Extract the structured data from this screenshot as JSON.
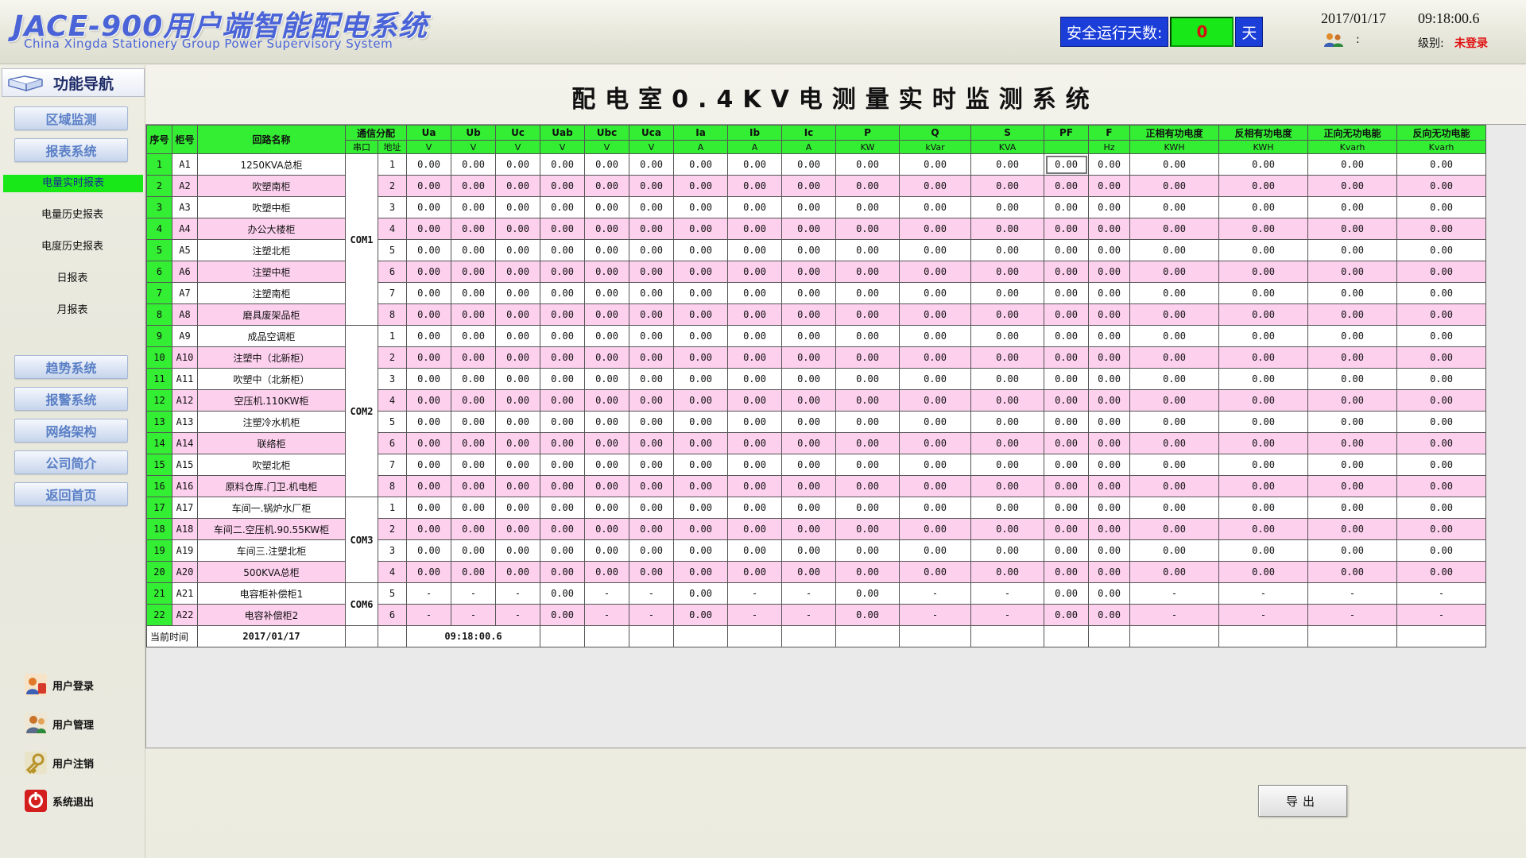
{
  "header": {
    "title": "JACE-900用户端智能配电系统",
    "subtitle": "China Xingda Stationery Group Power Supervisory System",
    "safe_days_label": "安全运行天数:",
    "safe_days_value": "0",
    "safe_days_unit": "天",
    "date": "2017/01/17",
    "time": "09:18:00.6",
    "colon": ":",
    "level_label": "级别:",
    "level_value": "未登录"
  },
  "sidebar": {
    "nav_title": "功能导航",
    "buttons_top": [
      "区域监测",
      "报表系统"
    ],
    "sub_items": [
      "电量实时报表",
      "电量历史报表",
      "电度历史报表",
      "日报表",
      "月报表"
    ],
    "active_sub": 0,
    "buttons_mid": [
      "趋势系统",
      "报警系统",
      "网络架构",
      "公司简介",
      "返回首页"
    ],
    "actions": [
      "用户登录",
      "用户管理",
      "用户注销",
      "系统退出"
    ]
  },
  "main": {
    "title": "配电室0.4KV电测量实时监测系统",
    "export_label": "导出"
  },
  "table": {
    "head": {
      "seq": "序号",
      "cabinet": "柜号",
      "circuit": "回路名称",
      "comm": "通信分配",
      "port": "串口",
      "addr": "地址"
    },
    "measure_columns": [
      {
        "name": "Ua",
        "unit": "V"
      },
      {
        "name": "Ub",
        "unit": "V"
      },
      {
        "name": "Uc",
        "unit": "V"
      },
      {
        "name": "Uab",
        "unit": "V"
      },
      {
        "name": "Ubc",
        "unit": "V"
      },
      {
        "name": "Uca",
        "unit": "V"
      },
      {
        "name": "Ia",
        "unit": "A"
      },
      {
        "name": "Ib",
        "unit": "A"
      },
      {
        "name": "Ic",
        "unit": "A"
      },
      {
        "name": "P",
        "unit": "KW"
      },
      {
        "name": "Q",
        "unit": "kVar"
      },
      {
        "name": "S",
        "unit": "KVA"
      },
      {
        "name": "PF",
        "unit": ""
      },
      {
        "name": "F",
        "unit": "Hz"
      },
      {
        "name": "正相有功电度",
        "unit": "KWH"
      },
      {
        "name": "反相有功电度",
        "unit": "KWH"
      },
      {
        "name": "正向无功电能",
        "unit": "Kvarh"
      },
      {
        "name": "反向无功电能",
        "unit": "Kvarh"
      }
    ],
    "com_groups": [
      {
        "label": "COM1",
        "start": 0,
        "span": 8
      },
      {
        "label": "COM2",
        "start": 8,
        "span": 8
      },
      {
        "label": "COM3",
        "start": 16,
        "span": 4
      },
      {
        "label": "COM6",
        "start": 20,
        "span": 2
      }
    ],
    "rows": [
      {
        "seq": "1",
        "cab": "A1",
        "name": "1250KVA总柜",
        "addr": "1",
        "vals": [
          "0.00",
          "0.00",
          "0.00",
          "0.00",
          "0.00",
          "0.00",
          "0.00",
          "0.00",
          "0.00",
          "0.00",
          "0.00",
          "0.00",
          "0.00",
          "0.00",
          "0.00",
          "0.00",
          "0.00",
          "0.00"
        ]
      },
      {
        "seq": "2",
        "cab": "A2",
        "name": "吹塑南柜",
        "addr": "2",
        "vals": [
          "0.00",
          "0.00",
          "0.00",
          "0.00",
          "0.00",
          "0.00",
          "0.00",
          "0.00",
          "0.00",
          "0.00",
          "0.00",
          "0.00",
          "0.00",
          "0.00",
          "0.00",
          "0.00",
          "0.00",
          "0.00"
        ]
      },
      {
        "seq": "3",
        "cab": "A3",
        "name": "吹塑中柜",
        "addr": "3",
        "vals": [
          "0.00",
          "0.00",
          "0.00",
          "0.00",
          "0.00",
          "0.00",
          "0.00",
          "0.00",
          "0.00",
          "0.00",
          "0.00",
          "0.00",
          "0.00",
          "0.00",
          "0.00",
          "0.00",
          "0.00",
          "0.00"
        ]
      },
      {
        "seq": "4",
        "cab": "A4",
        "name": "办公大楼柜",
        "addr": "4",
        "vals": [
          "0.00",
          "0.00",
          "0.00",
          "0.00",
          "0.00",
          "0.00",
          "0.00",
          "0.00",
          "0.00",
          "0.00",
          "0.00",
          "0.00",
          "0.00",
          "0.00",
          "0.00",
          "0.00",
          "0.00",
          "0.00"
        ]
      },
      {
        "seq": "5",
        "cab": "A5",
        "name": "注塑北柜",
        "addr": "5",
        "vals": [
          "0.00",
          "0.00",
          "0.00",
          "0.00",
          "0.00",
          "0.00",
          "0.00",
          "0.00",
          "0.00",
          "0.00",
          "0.00",
          "0.00",
          "0.00",
          "0.00",
          "0.00",
          "0.00",
          "0.00",
          "0.00"
        ]
      },
      {
        "seq": "6",
        "cab": "A6",
        "name": "注塑中柜",
        "addr": "6",
        "vals": [
          "0.00",
          "0.00",
          "0.00",
          "0.00",
          "0.00",
          "0.00",
          "0.00",
          "0.00",
          "0.00",
          "0.00",
          "0.00",
          "0.00",
          "0.00",
          "0.00",
          "0.00",
          "0.00",
          "0.00",
          "0.00"
        ]
      },
      {
        "seq": "7",
        "cab": "A7",
        "name": "注塑南柜",
        "addr": "7",
        "vals": [
          "0.00",
          "0.00",
          "0.00",
          "0.00",
          "0.00",
          "0.00",
          "0.00",
          "0.00",
          "0.00",
          "0.00",
          "0.00",
          "0.00",
          "0.00",
          "0.00",
          "0.00",
          "0.00",
          "0.00",
          "0.00"
        ]
      },
      {
        "seq": "8",
        "cab": "A8",
        "name": "磨具废架品柜",
        "addr": "8",
        "vals": [
          "0.00",
          "0.00",
          "0.00",
          "0.00",
          "0.00",
          "0.00",
          "0.00",
          "0.00",
          "0.00",
          "0.00",
          "0.00",
          "0.00",
          "0.00",
          "0.00",
          "0.00",
          "0.00",
          "0.00",
          "0.00"
        ]
      },
      {
        "seq": "9",
        "cab": "A9",
        "name": "成品空调柜",
        "addr": "1",
        "vals": [
          "0.00",
          "0.00",
          "0.00",
          "0.00",
          "0.00",
          "0.00",
          "0.00",
          "0.00",
          "0.00",
          "0.00",
          "0.00",
          "0.00",
          "0.00",
          "0.00",
          "0.00",
          "0.00",
          "0.00",
          "0.00"
        ]
      },
      {
        "seq": "10",
        "cab": "A10",
        "name": "注塑中（北新柜）",
        "addr": "2",
        "vals": [
          "0.00",
          "0.00",
          "0.00",
          "0.00",
          "0.00",
          "0.00",
          "0.00",
          "0.00",
          "0.00",
          "0.00",
          "0.00",
          "0.00",
          "0.00",
          "0.00",
          "0.00",
          "0.00",
          "0.00",
          "0.00"
        ]
      },
      {
        "seq": "11",
        "cab": "A11",
        "name": "吹塑中（北新柜）",
        "addr": "3",
        "vals": [
          "0.00",
          "0.00",
          "0.00",
          "0.00",
          "0.00",
          "0.00",
          "0.00",
          "0.00",
          "0.00",
          "0.00",
          "0.00",
          "0.00",
          "0.00",
          "0.00",
          "0.00",
          "0.00",
          "0.00",
          "0.00"
        ]
      },
      {
        "seq": "12",
        "cab": "A12",
        "name": "空压机.110KW柜",
        "addr": "4",
        "vals": [
          "0.00",
          "0.00",
          "0.00",
          "0.00",
          "0.00",
          "0.00",
          "0.00",
          "0.00",
          "0.00",
          "0.00",
          "0.00",
          "0.00",
          "0.00",
          "0.00",
          "0.00",
          "0.00",
          "0.00",
          "0.00"
        ]
      },
      {
        "seq": "13",
        "cab": "A13",
        "name": "注塑冷水机柜",
        "addr": "5",
        "vals": [
          "0.00",
          "0.00",
          "0.00",
          "0.00",
          "0.00",
          "0.00",
          "0.00",
          "0.00",
          "0.00",
          "0.00",
          "0.00",
          "0.00",
          "0.00",
          "0.00",
          "0.00",
          "0.00",
          "0.00",
          "0.00"
        ]
      },
      {
        "seq": "14",
        "cab": "A14",
        "name": "联络柜",
        "addr": "6",
        "vals": [
          "0.00",
          "0.00",
          "0.00",
          "0.00",
          "0.00",
          "0.00",
          "0.00",
          "0.00",
          "0.00",
          "0.00",
          "0.00",
          "0.00",
          "0.00",
          "0.00",
          "0.00",
          "0.00",
          "0.00",
          "0.00"
        ]
      },
      {
        "seq": "15",
        "cab": "A15",
        "name": "吹塑北柜",
        "addr": "7",
        "vals": [
          "0.00",
          "0.00",
          "0.00",
          "0.00",
          "0.00",
          "0.00",
          "0.00",
          "0.00",
          "0.00",
          "0.00",
          "0.00",
          "0.00",
          "0.00",
          "0.00",
          "0.00",
          "0.00",
          "0.00",
          "0.00"
        ]
      },
      {
        "seq": "16",
        "cab": "A16",
        "name": "原料仓库.门卫.机电柜",
        "addr": "8",
        "vals": [
          "0.00",
          "0.00",
          "0.00",
          "0.00",
          "0.00",
          "0.00",
          "0.00",
          "0.00",
          "0.00",
          "0.00",
          "0.00",
          "0.00",
          "0.00",
          "0.00",
          "0.00",
          "0.00",
          "0.00",
          "0.00"
        ]
      },
      {
        "seq": "17",
        "cab": "A17",
        "name": "车间一.锅炉水厂柜",
        "addr": "1",
        "vals": [
          "0.00",
          "0.00",
          "0.00",
          "0.00",
          "0.00",
          "0.00",
          "0.00",
          "0.00",
          "0.00",
          "0.00",
          "0.00",
          "0.00",
          "0.00",
          "0.00",
          "0.00",
          "0.00",
          "0.00",
          "0.00"
        ]
      },
      {
        "seq": "18",
        "cab": "A18",
        "name": "车间二.空压机.90.55KW柜",
        "addr": "2",
        "vals": [
          "0.00",
          "0.00",
          "0.00",
          "0.00",
          "0.00",
          "0.00",
          "0.00",
          "0.00",
          "0.00",
          "0.00",
          "0.00",
          "0.00",
          "0.00",
          "0.00",
          "0.00",
          "0.00",
          "0.00",
          "0.00"
        ]
      },
      {
        "seq": "19",
        "cab": "A19",
        "name": "车间三.注塑北柜",
        "addr": "3",
        "vals": [
          "0.00",
          "0.00",
          "0.00",
          "0.00",
          "0.00",
          "0.00",
          "0.00",
          "0.00",
          "0.00",
          "0.00",
          "0.00",
          "0.00",
          "0.00",
          "0.00",
          "0.00",
          "0.00",
          "0.00",
          "0.00"
        ]
      },
      {
        "seq": "20",
        "cab": "A20",
        "name": "500KVA总柜",
        "addr": "4",
        "vals": [
          "0.00",
          "0.00",
          "0.00",
          "0.00",
          "0.00",
          "0.00",
          "0.00",
          "0.00",
          "0.00",
          "0.00",
          "0.00",
          "0.00",
          "0.00",
          "0.00",
          "0.00",
          "0.00",
          "0.00",
          "0.00"
        ]
      },
      {
        "seq": "21",
        "cab": "A21",
        "name": "电容柜补偿柜1",
        "addr": "5",
        "vals": [
          "-",
          "-",
          "-",
          "0.00",
          "-",
          "-",
          "0.00",
          "-",
          "-",
          "0.00",
          "-",
          "-",
          "0.00",
          "0.00",
          "-",
          "-",
          "-",
          "-"
        ]
      },
      {
        "seq": "22",
        "cab": "A22",
        "name": "电容补偿柜2",
        "addr": "6",
        "vals": [
          "-",
          "-",
          "-",
          "0.00",
          "-",
          "-",
          "0.00",
          "-",
          "-",
          "0.00",
          "-",
          "-",
          "0.00",
          "0.00",
          "-",
          "-",
          "-",
          "-"
        ]
      }
    ],
    "selected_cell": {
      "row": 0,
      "col": 12
    },
    "footer": {
      "label": "当前时间",
      "date": "2017/01/17",
      "time": "09:18:00.6"
    }
  },
  "colors": {
    "header_green": "#33ee33",
    "row_pink": "#fdd0ee",
    "title_blue": "#4a64d8",
    "safe_days_bg": "#1b3dd8",
    "alert_red": "#e01010"
  }
}
